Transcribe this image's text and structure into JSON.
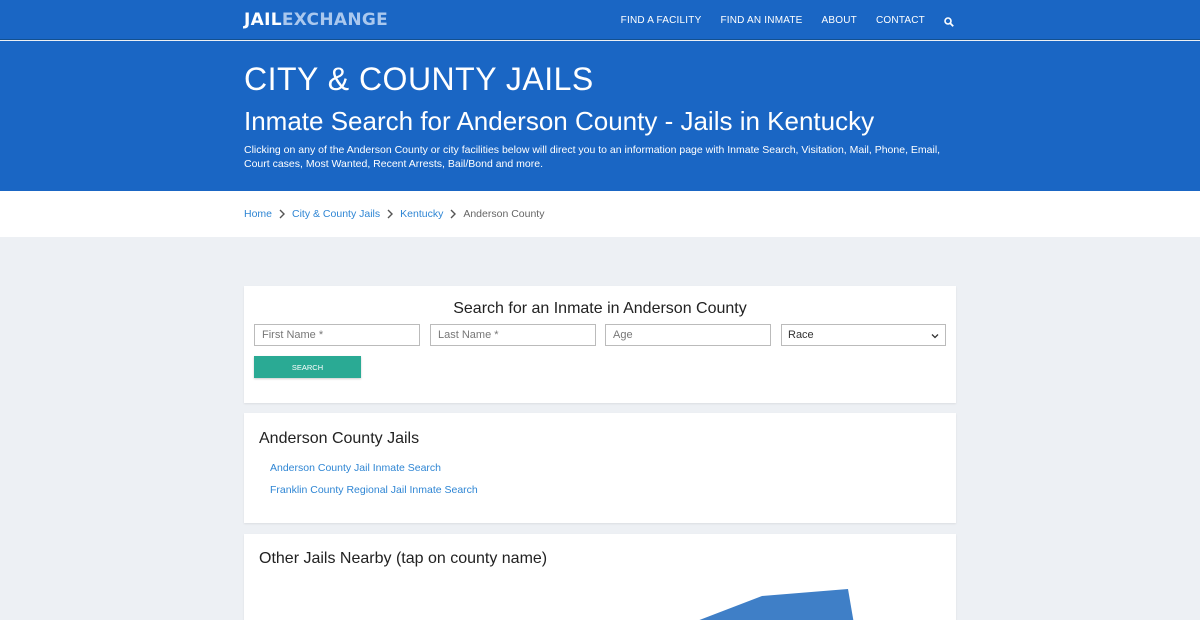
{
  "nav": {
    "logo_part1": "JAIL",
    "logo_part2": "EXCHANGE",
    "links": [
      "FIND A FACILITY",
      "FIND AN INMATE",
      "ABOUT",
      "CONTACT"
    ],
    "search_icon": "search-icon"
  },
  "hero": {
    "title": "CITY & COUNTY JAILS",
    "subtitle": "Inmate Search for Anderson County - Jails in Kentucky",
    "description": "Clicking on any of the Anderson County or city facilities below will direct you to an information page with Inmate Search, Visitation, Mail, Phone, Email, Court cases, Most Wanted, Recent Arrests, Bail/Bond and more."
  },
  "breadcrumb": {
    "items": [
      "Home",
      "City & County Jails",
      "Kentucky"
    ],
    "current": "Anderson County"
  },
  "search_form": {
    "title": "Search for an Inmate in Anderson County",
    "first_name_placeholder": "First Name *",
    "last_name_placeholder": "Last Name *",
    "age_placeholder": "Age",
    "race_selected": "Race",
    "submit_label": "SEARCH"
  },
  "jails": {
    "title": "Anderson County Jails",
    "links": [
      "Anderson County Jail Inmate Search",
      "Franklin County Regional Jail Inmate Search"
    ]
  },
  "nearby": {
    "title": "Other Jails Nearby (tap on county name)"
  },
  "colors": {
    "brand_blue": "#1a66c4",
    "link_blue": "#2f86d4",
    "button_teal": "#2aaa94",
    "map_blue": "#3f7fc7"
  }
}
